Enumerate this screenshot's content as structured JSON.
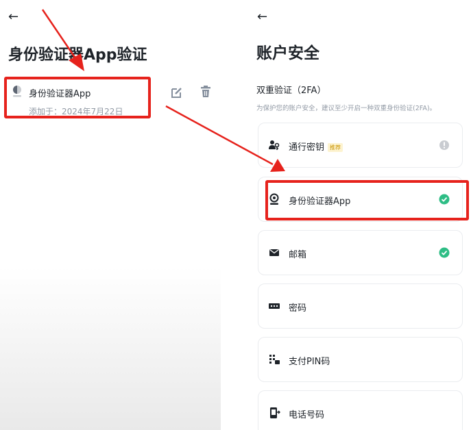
{
  "left": {
    "back_glyph": "←",
    "title": "身份验证器App验证",
    "item": {
      "name": "身份验证器App",
      "added": "添加于：2024年7月22日"
    },
    "edit_icon": "edit-icon",
    "delete_icon": "trash-icon"
  },
  "right": {
    "back_glyph": "←",
    "title": "账户安全",
    "section_title": "双重验证（2FA）",
    "section_desc": "为保护您的账户安全，建议至少开启一种双重身份验证(2FA)。",
    "items": [
      {
        "label": "通行密钥",
        "badge": "推荐",
        "status": "info",
        "icon": "passkey-icon"
      },
      {
        "label": "身份验证器App",
        "status": "enabled",
        "icon": "authenticator-icon"
      },
      {
        "label": "邮箱",
        "status": "enabled",
        "icon": "mail-icon"
      },
      {
        "label": "密码",
        "status": "none",
        "icon": "password-icon"
      },
      {
        "label": "支付PIN码",
        "status": "none",
        "icon": "pin-icon"
      },
      {
        "label": "电话号码",
        "status": "none",
        "icon": "phone-icon"
      }
    ]
  },
  "colors": {
    "accent_red": "#e6221c",
    "success_green": "#2ebd85",
    "muted_gray": "#929aa5",
    "badge_bg": "#fdf3d0",
    "badge_text": "#c99400"
  }
}
